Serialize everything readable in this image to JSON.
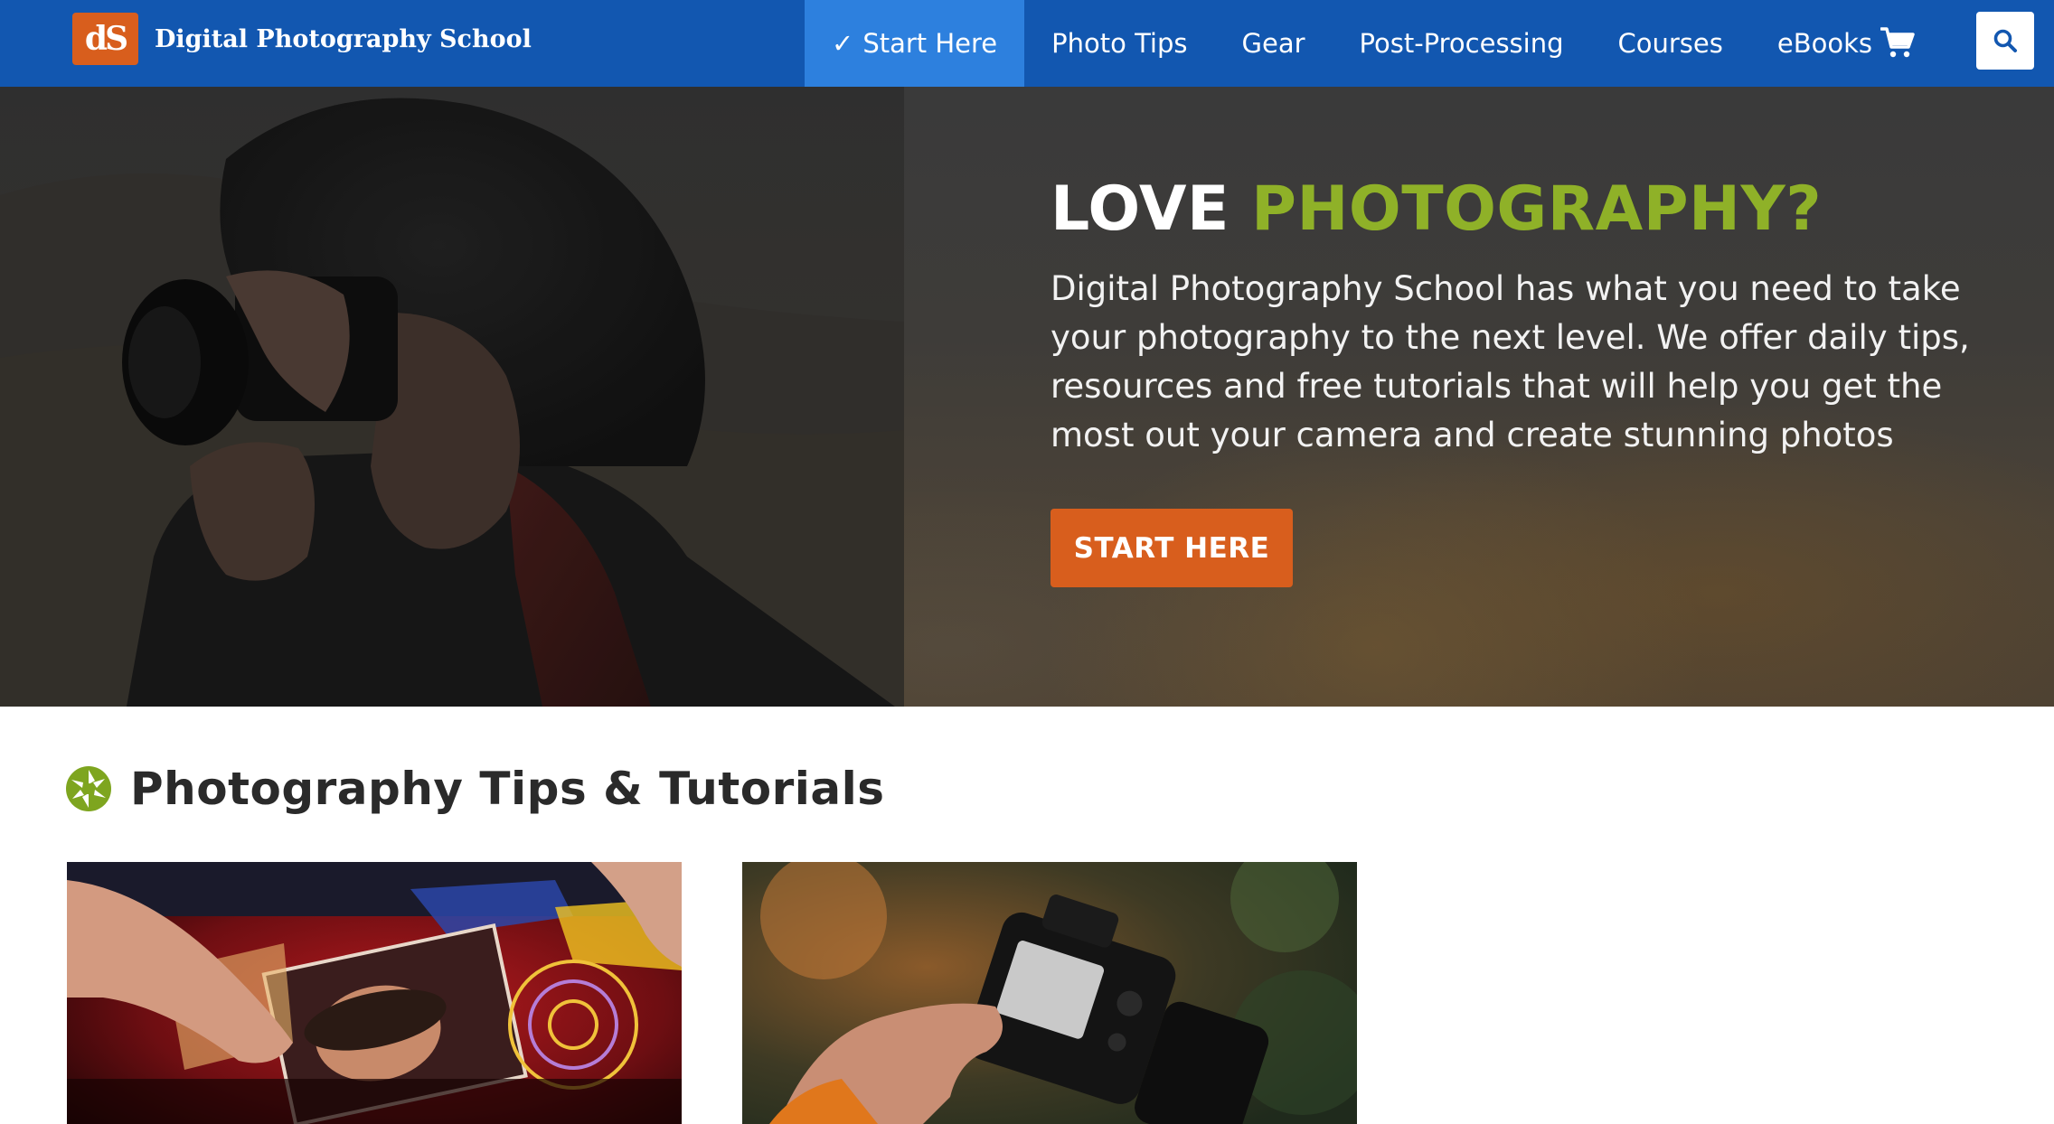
{
  "header": {
    "logo_mark": "dS",
    "site_name": "Digital Photography School",
    "nav": [
      {
        "label": "Start Here",
        "active": true,
        "check": "✓"
      },
      {
        "label": "Photo Tips",
        "active": false
      },
      {
        "label": "Gear",
        "active": false
      },
      {
        "label": "Post-Processing",
        "active": false
      },
      {
        "label": "Courses",
        "active": false
      },
      {
        "label": "eBooks",
        "active": false
      }
    ],
    "cart_icon": "cart-icon",
    "search_icon": "search-icon"
  },
  "hero": {
    "title_plain": "LOVE",
    "title_accent": "PHOTOGRAPHY?",
    "text": "Digital Photography School has what you need to take your photography to the next level. We offer daily tips, resources and free tutorials that will help you get the most out your camera and create stunning photos",
    "button_label": "START HERE"
  },
  "section": {
    "icon": "aperture-icon",
    "title": "Photography Tips & Tutorials"
  },
  "colors": {
    "header_bg": "#1257b0",
    "nav_active_bg": "#2d80de",
    "accent_green": "#8fb128",
    "cta_orange": "#d85e1d"
  }
}
